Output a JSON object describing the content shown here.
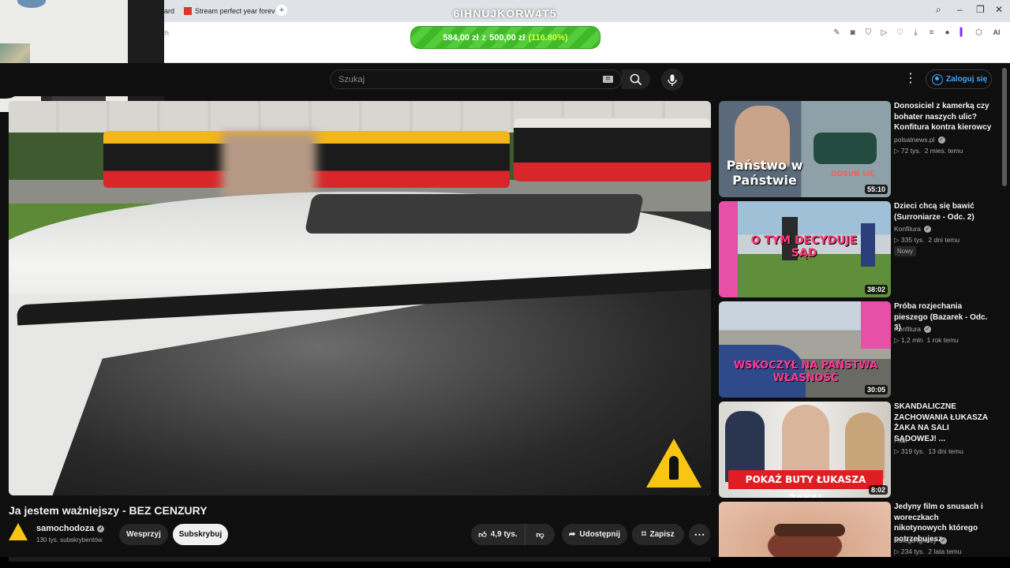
{
  "browser": {
    "tab_partial": "ard",
    "tab_stream": "Stream perfect year forev",
    "new_tab": "+",
    "overlay_code": "6IHNUJKORW4T5",
    "address_partial": "tch",
    "ai_button": "AI"
  },
  "donation": {
    "current": "584,00 zł",
    "separator": "z",
    "goal": "500,00 zł",
    "percent": "(116.80%)"
  },
  "header": {
    "search_placeholder": "Szukaj",
    "login_label": "Zaloguj się"
  },
  "video": {
    "title": "Ja jestem ważniejszy - BEZ CENZURY",
    "channel": "samochodoza",
    "subscribers": "130 tys. subskrybentów",
    "support_label": "Wesprzyj",
    "subscribe_label": "Subskrybuj",
    "likes": "4,9 tys.",
    "share_label": "Udostępnij",
    "save_label": "Zapisz"
  },
  "recommendations": [
    {
      "title": "Donosiciel z kamerką czy bohater naszych ulic? Konfitura kontra kierowcy",
      "channel": "polsatnews.pl",
      "views": "72 tys.",
      "age": "2 mies. temu",
      "duration": "55:10",
      "thumb_text": "Państwo w Państwie",
      "thumb_badge": "ODSUŃ SIĘ"
    },
    {
      "title": "Dzieci chcą się bawić (Surroniarze - Odc. 2)",
      "channel": "Konfitura",
      "views": "335 tys.",
      "age": "2 dni temu",
      "duration": "38:02",
      "badge": "Nowy",
      "thumb_text": "O TYM DECYDUJE SĄD"
    },
    {
      "title": "Próba rozjechania pieszego (Bazarek - Odc. 3)",
      "channel": "Konfitura",
      "views": "1,2 mln",
      "age": "1 rok temu",
      "duration": "30:05",
      "thumb_text": "WSKOCZYŁ NA PAŃSTWA WŁASNOŚĆ"
    },
    {
      "title": "SKANDALICZNE ZACHOWANIA ŁUKASZA ŻAKA NA SALI SĄDOWEJ! ...",
      "channel": "Fakt",
      "views": "319 tys.",
      "age": "13 dni temu",
      "duration": "8:02",
      "thumb_text": "POKAŻ BUTY ŁUKASZA ŻAKA!"
    },
    {
      "title": "Jedyny film o snusach i woreczkach nikotynowych którego potrzebujesz",
      "channel": "Kolega Ignacy",
      "views": "234 tys.",
      "age": "2 lata temu"
    }
  ]
}
